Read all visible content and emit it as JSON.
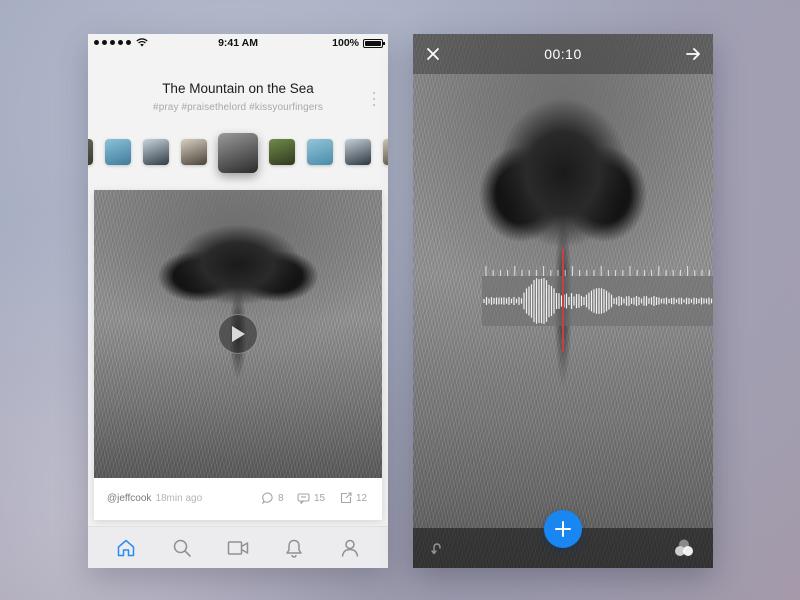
{
  "status_bar": {
    "time": "9:41 AM",
    "battery": "100%",
    "battery_level": 1.0
  },
  "feed": {
    "title": "The Mountain on the Sea",
    "hashtags": "#pray #praisethelord #kissyourfingers",
    "thumbnails": [
      {
        "name": "thumb-partial-left",
        "colors": [
          "#6d6b58",
          "#3b3a2f"
        ]
      },
      {
        "name": "thumb-ocean-1",
        "colors": [
          "#8cc3d9",
          "#3e7a9a"
        ]
      },
      {
        "name": "thumb-city-1",
        "colors": [
          "#c9d3da",
          "#2e3b46"
        ]
      },
      {
        "name": "thumb-cactus",
        "colors": [
          "#d7cfc0",
          "#4a4238"
        ]
      },
      {
        "name": "thumb-cat-nose",
        "colors": [
          "#9a9a9a",
          "#2b2b2b"
        ],
        "active": true
      },
      {
        "name": "thumb-tree",
        "colors": [
          "#6f8b4a",
          "#2f3a1e"
        ]
      },
      {
        "name": "thumb-ocean-2",
        "colors": [
          "#92c6da",
          "#4a8aa8"
        ]
      },
      {
        "name": "thumb-city-2",
        "colors": [
          "#c6d0d8",
          "#2a3540"
        ]
      },
      {
        "name": "thumb-partial-right",
        "colors": [
          "#cfc7b6",
          "#4b443a"
        ]
      }
    ],
    "post": {
      "author": "@jeffcook",
      "time_ago": "18min ago",
      "comments": "8",
      "reposts": "15",
      "shares": "12"
    },
    "tabs": [
      {
        "name": "home",
        "icon": "home-icon",
        "active": true
      },
      {
        "name": "search",
        "icon": "search-icon",
        "active": false
      },
      {
        "name": "video",
        "icon": "video-camera-icon",
        "active": false
      },
      {
        "name": "notifications",
        "icon": "bell-icon",
        "active": false
      },
      {
        "name": "profile",
        "icon": "user-icon",
        "active": false
      }
    ]
  },
  "editor": {
    "elapsed": "00:10",
    "icons": {
      "close": "close-icon",
      "next": "arrow-right-icon",
      "undo": "undo-icon",
      "filters": "filters-icon",
      "add": "plus-icon"
    },
    "playhead_color": "#c64242"
  },
  "colors": {
    "accent": "#1a86f2",
    "tab_active": "#2a8bf2",
    "tab_inactive": "#8f8f95"
  }
}
